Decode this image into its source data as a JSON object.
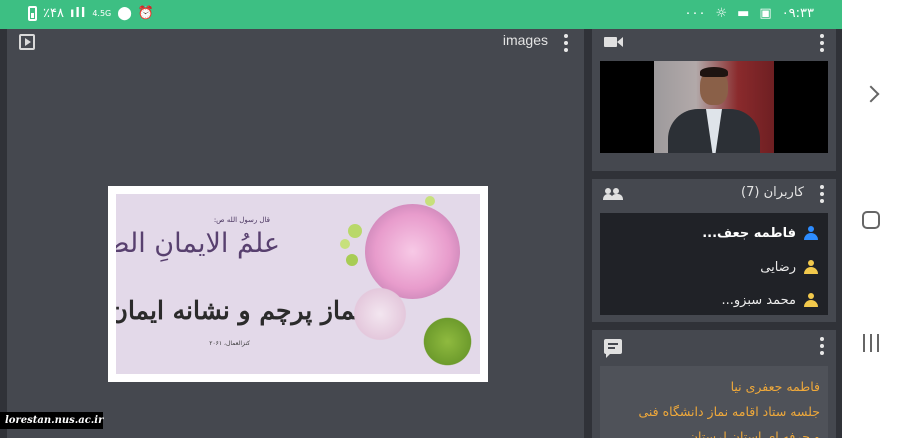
{
  "status_bar": {
    "time": "۰۹:۳۳",
    "more": "۰۰۰",
    "battery": "٪۴۸",
    "network": "4.5G",
    "icons": [
      "battery-icon",
      "signal-icon",
      "network-icon",
      "location-icon",
      "alarm-icon",
      "brightness-icon",
      "message-icon",
      "gallery-icon"
    ]
  },
  "presentation": {
    "title": "images",
    "slide": {
      "heading_small": "قال رسول الله ص:",
      "hadith": "علمُ الایمانِ الصلاةُ",
      "main_text": "نماز پرچم و نشانه ایمان است",
      "reference": "کنزالعمال، ۲۰۶۱"
    }
  },
  "camera": {
    "icon": "video-camera-icon"
  },
  "users": {
    "title": "کاربران (7)",
    "list": [
      {
        "name": "فاطمه جعف...",
        "color": "#2d8cff",
        "bold": true
      },
      {
        "name": "رضایی",
        "color": "#f2c94c",
        "bold": false
      },
      {
        "name": "محمد سبزو...",
        "color": "#f2c94c",
        "bold": false
      }
    ]
  },
  "chat": {
    "lines": [
      "فاطمه جعفری نیا",
      "جلسه ستاد اقامه نماز دانشگاه فنی",
      "و حرفه ای استان لرستان"
    ]
  },
  "watermark": "lorestan.nus.ac.ir",
  "colors": {
    "status_bar": "#3dbf83",
    "background": "#303238",
    "panel": "#45484f",
    "chat_text": "#f0a93a"
  }
}
